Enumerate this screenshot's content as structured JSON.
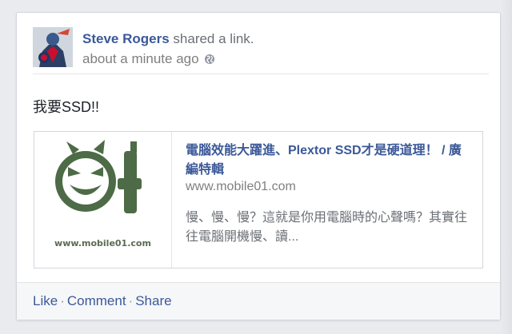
{
  "post": {
    "author": "Steve Rogers",
    "action_text": "shared a link.",
    "timestamp": "about a minute ago",
    "privacy_icon": "globe-icon",
    "message": "我要SSD!!"
  },
  "link_preview": {
    "title": "電腦效能大躍進、Plextor SSD才是硬道理！ / 廣編特輯",
    "domain": "www.mobile01.com",
    "description": "慢、慢、慢？這就是你用電腦時的心聲嗎？其實往往電腦開機慢、讀...",
    "thumbnail_caption": "www.mobile01.com"
  },
  "footer": {
    "like": "Like",
    "comment": "Comment",
    "share": "Share",
    "separator": "·"
  },
  "colors": {
    "link_blue": "#3b5998",
    "logo_green": "#4d6b46",
    "footer_bg": "#f6f7f9"
  }
}
